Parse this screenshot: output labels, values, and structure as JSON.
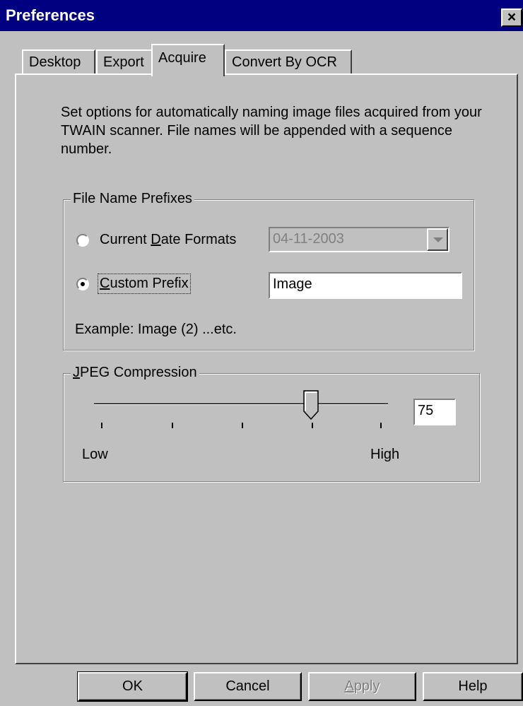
{
  "window": {
    "title": "Preferences",
    "close_label": "×"
  },
  "tabs": [
    {
      "label": "Desktop"
    },
    {
      "label": "Export"
    },
    {
      "label": "Acquire",
      "active": true
    },
    {
      "label": "Convert By OCR"
    }
  ],
  "description": "Set options for automatically naming image files acquired from your TWAIN scanner. File names will be appended with a sequence number.",
  "file_name_prefixes": {
    "legend": "File Name Prefixes",
    "date_option": {
      "label": "Current Date Formats",
      "selected": false
    },
    "date_value": "04-11-2003",
    "custom_option": {
      "label": "Custom Prefix",
      "selected": true
    },
    "custom_value": "Image",
    "example": "Example: Image (2) ...etc."
  },
  "jpeg": {
    "legend": "JPEG Compression",
    "value": "75",
    "slider_level": 0.75,
    "low_label": "Low",
    "high_label": "High"
  },
  "buttons": {
    "ok": "OK",
    "cancel": "Cancel",
    "apply": "Apply",
    "help": "Help"
  }
}
